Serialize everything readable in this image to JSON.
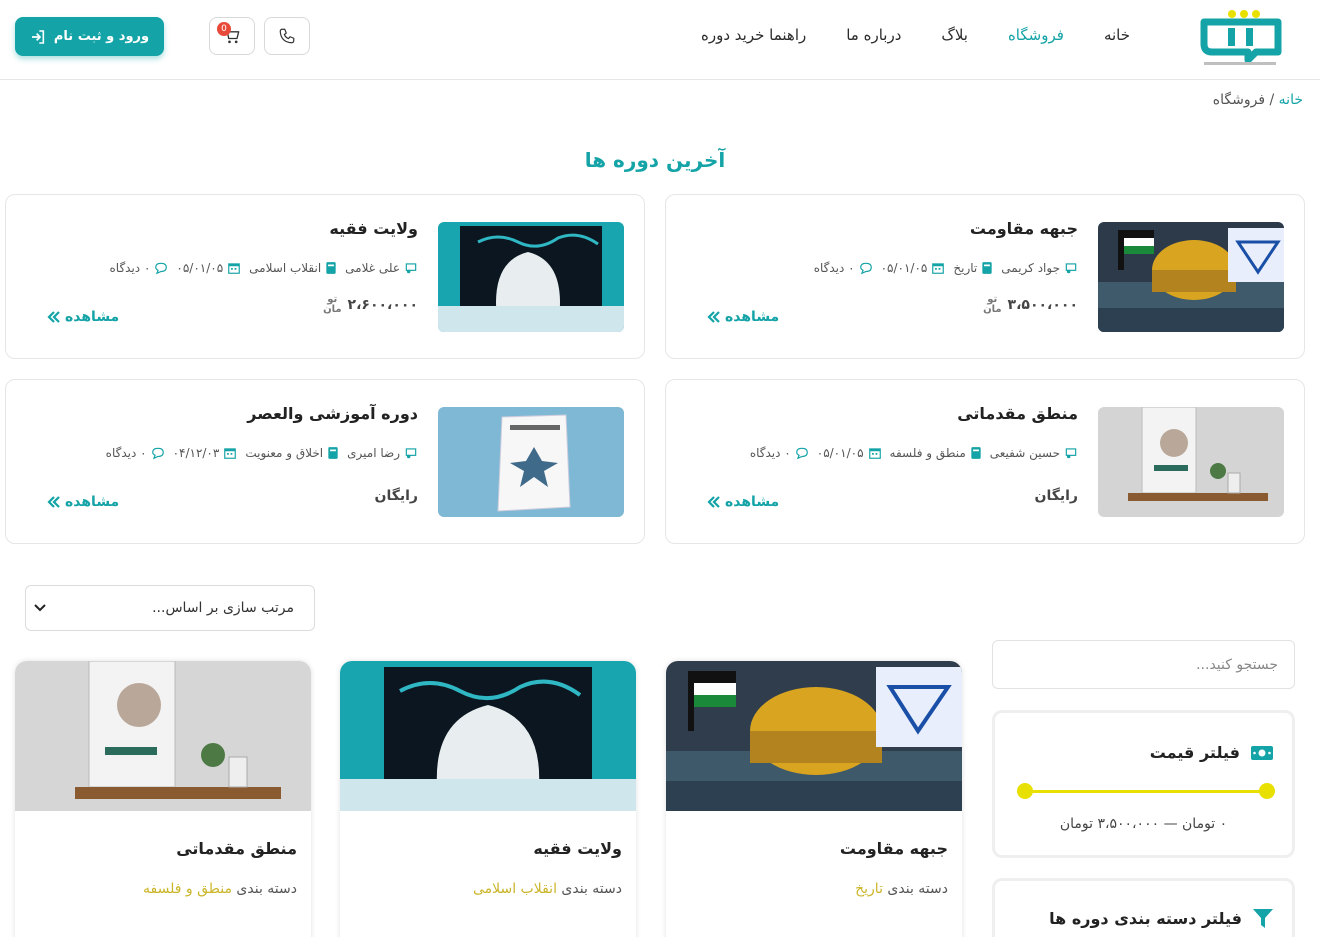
{
  "header": {
    "nav": [
      {
        "label": "خانه",
        "active": false
      },
      {
        "label": "فروشگاه",
        "active": true
      },
      {
        "label": "بلاگ",
        "active": false
      },
      {
        "label": "درباره ما",
        "active": false
      },
      {
        "label": "راهنما خرید دوره",
        "active": false
      }
    ],
    "cart_count": "0",
    "login_label": "ورود و ثبت نام",
    "colors": {
      "accent": "#14a3a6",
      "badge": "#e84a3a"
    }
  },
  "breadcrumb": {
    "home": "خانه",
    "separator": "/",
    "current": "فروشگاه"
  },
  "latest": {
    "title": "آخرین دوره ها",
    "view_label": "مشاهده",
    "currency": {
      "line1": "تو",
      "line2": "مان"
    },
    "cards": [
      {
        "title": "جبهه مقاومت",
        "teacher": "جواد کریمی",
        "category": "تاریخ",
        "date": "۰۵/۰۱/۰۵",
        "views": "۰ دیدگاه",
        "price": "۳،۵۰۰،۰۰۰",
        "image": "resistance"
      },
      {
        "title": "ولایت فقیه",
        "teacher": "علی غلامی",
        "category": "انقلاب اسلامی",
        "date": "۰۵/۰۱/۰۵",
        "views": "۰ دیدگاه",
        "price": "۲،۶۰۰،۰۰۰",
        "image": "veiled"
      },
      {
        "title": "منطق مقدماتی",
        "teacher": "حسین شفیعی",
        "category": "منطق و فلسفه",
        "date": "۰۵/۰۱/۰۵",
        "views": "۰ دیدگاه",
        "price_free": "رایگان",
        "image": "logic"
      },
      {
        "title": "دوره آموزشی والعصر",
        "teacher": "رضا امیری",
        "category": "اخلاق و معنویت",
        "date": "۰۴/۱۲/۰۳",
        "views": "۰ دیدگاه",
        "price_free": "رایگان",
        "image": "book"
      }
    ]
  },
  "sort": {
    "placeholder": "مرتب سازی بر اساس..."
  },
  "products": {
    "cat_label": "دسته بندی",
    "items": [
      {
        "title": "جبهه مقاومت",
        "category": "تاریخ"
      },
      {
        "title": "ولایت فقیه",
        "category": "انقلاب اسلامی"
      },
      {
        "title": "منطق مقدماتی",
        "category": "منطق و فلسفه"
      }
    ]
  },
  "sidebar": {
    "search_placeholder": "جستجو کنید...",
    "price_filter": {
      "title": "فیلتر قیمت",
      "range_text": "۰ تومان — ۳،۵۰۰،۰۰۰ تومان",
      "range_color": "#e8e000"
    },
    "category_filter": {
      "title": "فیلتر دسته بندی دوره ها"
    }
  }
}
